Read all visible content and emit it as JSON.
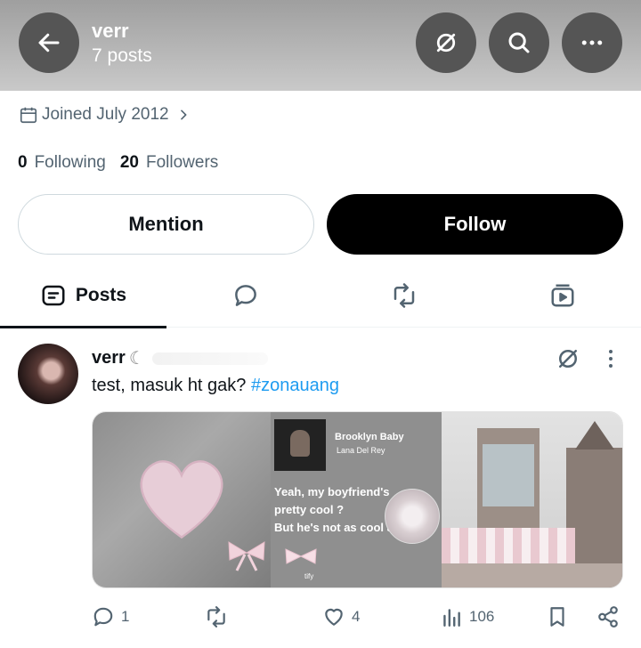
{
  "header": {
    "name": "verr",
    "post_count": "7 posts",
    "icons": [
      "back-arrow-icon",
      "grok-icon",
      "search-icon",
      "more-icon"
    ]
  },
  "profile": {
    "joined": "Joined July 2012",
    "following_count": "0",
    "following_label": "Following",
    "followers_count": "20",
    "followers_label": "Followers",
    "mention_label": "Mention",
    "follow_label": "Follow"
  },
  "tabs": {
    "posts_label": "Posts",
    "icons": [
      "posts-icon",
      "replies-icon",
      "reposts-icon",
      "media-icon"
    ]
  },
  "post": {
    "author": "verr",
    "author_suffix": "☾",
    "text": "test, masuk ht gak? ",
    "hashtag": "#zonauang",
    "media": {
      "song_title": "Brooklyn Baby",
      "artist": "Lana Del Rey",
      "lyric_1": "Yeah, my boyfriend's",
      "lyric_2": "pretty cool ?",
      "lyric_3": "But he's not as cool as",
      "brand": "tify"
    },
    "actions": {
      "replies": "1",
      "reposts": "",
      "likes": "4",
      "views": "106"
    }
  },
  "colors": {
    "header_bg": "#a8a8a8",
    "follow_bg": "#000000",
    "hashtag": "#1d9bf0",
    "muted_text": "#536471"
  }
}
